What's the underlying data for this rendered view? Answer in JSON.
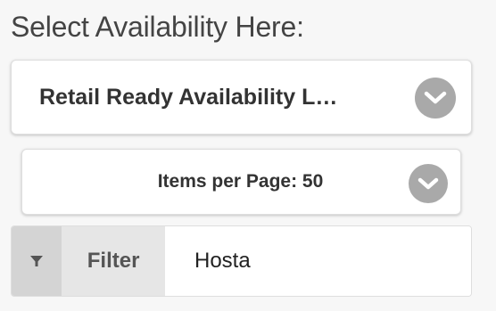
{
  "heading": "Select Availability Here:",
  "availability_select": {
    "selected_label": "Retail Ready Availability L…",
    "icon": "chevron-down-icon"
  },
  "items_per_page_select": {
    "selected_label": "Items per Page: 50",
    "icon": "chevron-down-icon"
  },
  "filter": {
    "icon": "filter-icon",
    "label": "Filter",
    "value": "Hosta"
  },
  "colors": {
    "chevron_bg": "#a9a9a9",
    "filter_icon_bg": "#d4d4d4",
    "filter_label_bg": "#e6e6e6"
  }
}
